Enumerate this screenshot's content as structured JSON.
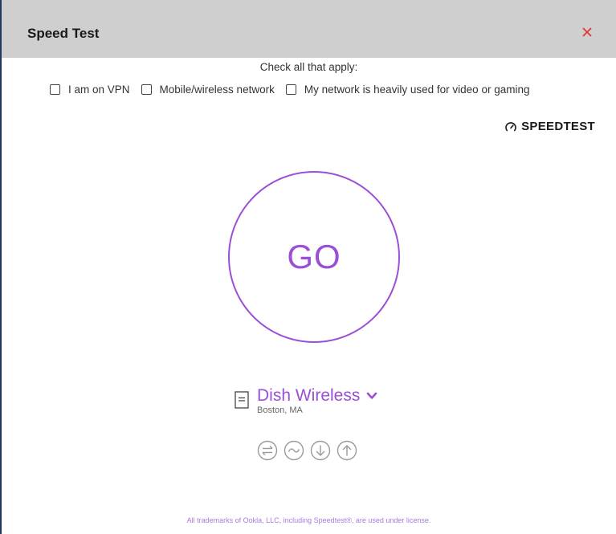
{
  "window": {
    "title": "Speed Test"
  },
  "options": {
    "heading": "Check all that apply:",
    "items": [
      {
        "label": "I am on VPN",
        "checked": false
      },
      {
        "label": "Mobile/wireless network",
        "checked": false
      },
      {
        "label": "My network is heavily used for video or gaming",
        "checked": false
      }
    ]
  },
  "brand": {
    "name": "SPEEDTEST",
    "icon": "speedometer-icon"
  },
  "go": {
    "label": "GO"
  },
  "server": {
    "name": "Dish Wireless",
    "location": "Boston, MA"
  },
  "metrics": {
    "icons": [
      "ping-icon",
      "jitter-icon",
      "download-icon",
      "upload-icon"
    ]
  },
  "footer": {
    "text": "All trademarks of Ookla, LLC, including Speedtest®, are used under license."
  },
  "colors": {
    "accent": "#9a4fd6",
    "close": "#e0342f",
    "titlebar": "#cfcfcf"
  }
}
